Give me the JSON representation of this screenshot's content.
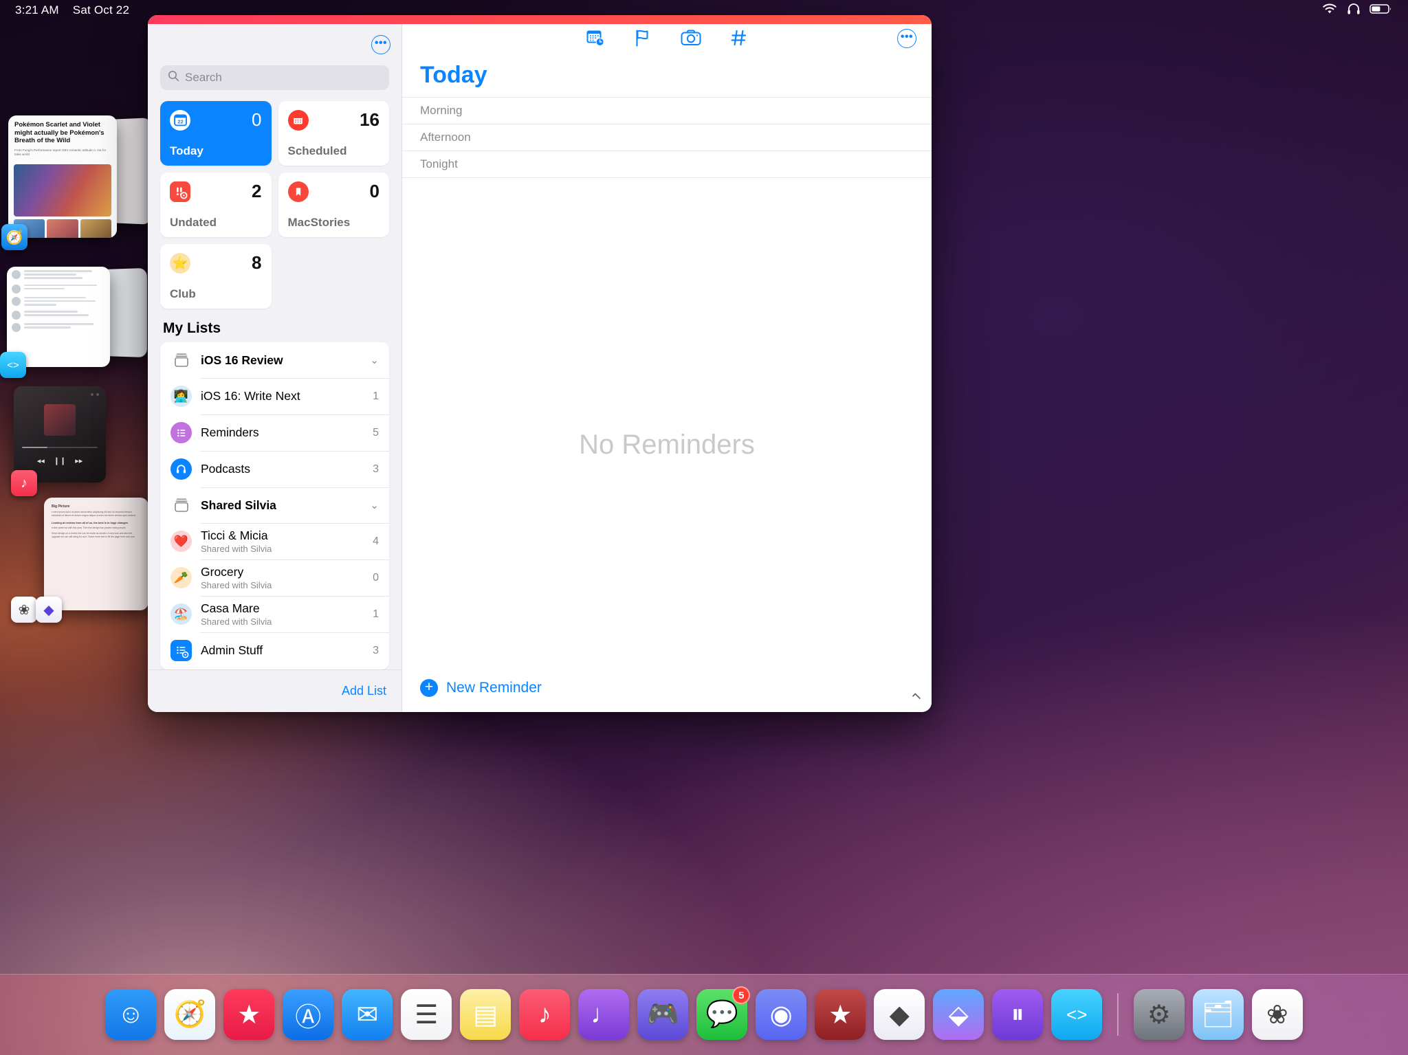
{
  "statusbar": {
    "time": "3:21 AM",
    "date": "Sat Oct 22",
    "icons": [
      "wifi-icon",
      "headphones-icon",
      "battery-icon"
    ]
  },
  "sidebar": {
    "more_button": "•••",
    "search": {
      "placeholder": "Search",
      "value": "",
      "icon": "search-icon"
    },
    "smart_lists": [
      {
        "label": "Today",
        "count": "0",
        "icon": "calendar-22-icon",
        "selected": true
      },
      {
        "label": "Scheduled",
        "count": "16",
        "icon": "calendar-icon",
        "selected": false
      },
      {
        "label": "Undated",
        "count": "2",
        "icon": "exclamation-gear-icon",
        "selected": false
      },
      {
        "label": "MacStories",
        "count": "0",
        "icon": "bookmark-icon",
        "selected": false
      },
      {
        "label": "Club",
        "count": "8",
        "icon": "star-emoji-icon",
        "selected": false
      }
    ],
    "my_lists_header": "My Lists",
    "lists": [
      {
        "title": "iOS 16 Review",
        "sub": "",
        "count": "",
        "icon": "group-stack-icon",
        "type": "group",
        "chevron": "⌄"
      },
      {
        "title": "iOS 16: Write Next",
        "sub": "",
        "count": "1",
        "icon": "person-laptop-emoji",
        "type": "list"
      },
      {
        "title": "Reminders",
        "sub": "",
        "count": "5",
        "icon": "list-bullet-icon",
        "type": "list"
      },
      {
        "title": "Podcasts",
        "sub": "",
        "count": "3",
        "icon": "headphones-icon",
        "type": "list"
      },
      {
        "title": "Shared Silvia",
        "sub": "",
        "count": "",
        "icon": "group-stack-icon",
        "type": "group",
        "chevron": "⌄"
      },
      {
        "title": "Ticci & Micia",
        "sub": "Shared with Silvia",
        "count": "4",
        "icon": "heart-emoji",
        "type": "list"
      },
      {
        "title": "Grocery",
        "sub": "Shared with Silvia",
        "count": "0",
        "icon": "carrot-emoji",
        "type": "list"
      },
      {
        "title": "Casa Mare",
        "sub": "Shared with Silvia",
        "count": "1",
        "icon": "beach-umbrella-emoji",
        "type": "list"
      },
      {
        "title": "Admin Stuff",
        "sub": "",
        "count": "3",
        "icon": "list-gear-icon",
        "type": "list"
      }
    ],
    "add_list": "Add List"
  },
  "detail": {
    "toolbar_icons": [
      "calendar-clock-icon",
      "flag-icon",
      "camera-icon",
      "hashtag-icon"
    ],
    "more_button": "•••",
    "title": "Today",
    "sections": [
      "Morning",
      "Afternoon",
      "Tonight"
    ],
    "empty_text": "No Reminders",
    "new_reminder": "New Reminder"
  },
  "dock": {
    "apps": [
      {
        "name": "finder",
        "glyph": "☺",
        "bg": "linear-gradient(180deg,#2f9bf7,#1377e8)",
        "badge": ""
      },
      {
        "name": "safari",
        "glyph": "🧭",
        "bg": "linear-gradient(180deg,#ffffff,#e9f2fb)",
        "badge": ""
      },
      {
        "name": "apple-tv",
        "glyph": "★",
        "bg": "linear-gradient(180deg,#ff3b5c,#e61c47)",
        "badge": ""
      },
      {
        "name": "app-store",
        "glyph": "Ⓐ",
        "bg": "linear-gradient(180deg,#3aa0ff,#0c6ee6)",
        "badge": ""
      },
      {
        "name": "mail",
        "glyph": "✉",
        "bg": "linear-gradient(180deg,#45b6ff,#1280f0)",
        "badge": ""
      },
      {
        "name": "reminders",
        "glyph": "☰",
        "bg": "linear-gradient(180deg,#ffffff,#f3f3f6)",
        "badge": ""
      },
      {
        "name": "notes",
        "glyph": "▤",
        "bg": "linear-gradient(180deg,#fdf0a8,#f7d94a)",
        "badge": ""
      },
      {
        "name": "music",
        "glyph": "♪",
        "bg": "linear-gradient(180deg,#fb5c74,#f62f4b)",
        "badge": ""
      },
      {
        "name": "overcast",
        "glyph": "♩",
        "bg": "linear-gradient(180deg,#b06cf0,#7a3ad6)",
        "badge": ""
      },
      {
        "name": "arcade",
        "glyph": "🎮",
        "bg": "linear-gradient(180deg,#8f7df0,#5b49d6)",
        "badge": ""
      },
      {
        "name": "messages",
        "glyph": "💬",
        "bg": "linear-gradient(180deg,#5ce16a,#1dbf3c)",
        "badge": "5"
      },
      {
        "name": "discord",
        "glyph": "◉",
        "bg": "linear-gradient(180deg,#7b8cf5,#5865f2)",
        "badge": ""
      },
      {
        "name": "reeder",
        "glyph": "★",
        "bg": "linear-gradient(180deg,#c24a4a,#8e1f23)",
        "badge": ""
      },
      {
        "name": "craft",
        "glyph": "◆",
        "bg": "linear-gradient(180deg,#ffffff,#eceaf4)",
        "badge": ""
      },
      {
        "name": "shortcuts",
        "glyph": "⬙",
        "bg": "linear-gradient(180deg,#5fa8ff,#b06cf0)",
        "badge": ""
      },
      {
        "name": "timery",
        "glyph": "⏸",
        "bg": "linear-gradient(180deg,#a05cf0,#6c3ad6)",
        "badge": ""
      },
      {
        "name": "textastic",
        "glyph": "<>",
        "bg": "linear-gradient(180deg,#46d3ff,#0fa9ef)",
        "badge": ""
      },
      {
        "name": "settings",
        "glyph": "⚙",
        "bg": "linear-gradient(180deg,#a9aeb6,#6e737c)",
        "badge": ""
      },
      {
        "name": "files",
        "glyph": "🗂",
        "bg": "linear-gradient(180deg,#bfe3ff,#7fc2f5)",
        "badge": ""
      },
      {
        "name": "photos",
        "glyph": "❀",
        "bg": "linear-gradient(180deg,#ffffff,#f0f0f4)",
        "badge": ""
      }
    ]
  },
  "background_thumbnails": {
    "news": {
      "title": "Pokémon Scarlet and Violet might actually be Pokémon's Breath of the Wild",
      "sub": "From Fungi's Performance report GB's romantic attitude o. ma for tales world"
    },
    "badges": [
      "safari-icon",
      "textastic-icon",
      "music-icon",
      "photos-icon",
      "craft-icon"
    ]
  }
}
